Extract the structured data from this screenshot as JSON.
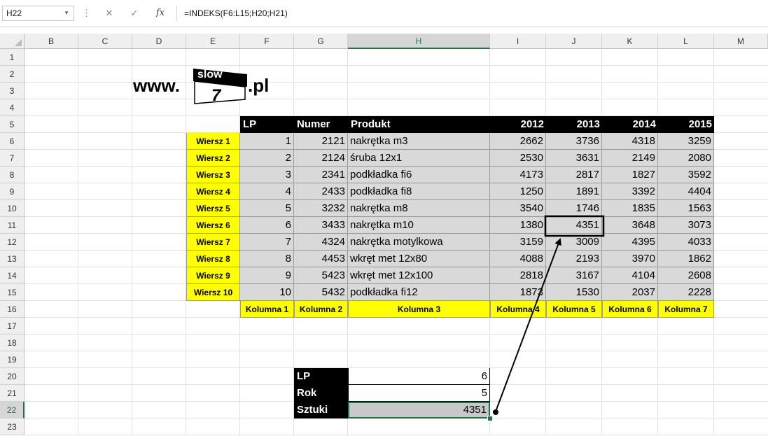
{
  "name_box": "H22",
  "formula": "=INDEKS(F6:L15;H20;H21)",
  "fx_label": "fx",
  "columns": [
    "B",
    "C",
    "D",
    "E",
    "F",
    "G",
    "H",
    "I",
    "J",
    "K",
    "L",
    "M"
  ],
  "rows": [
    "1",
    "2",
    "3",
    "4",
    "5",
    "6",
    "7",
    "8",
    "9",
    "10",
    "11",
    "12",
    "13",
    "14",
    "15",
    "16",
    "17",
    "18",
    "19",
    "20",
    "21",
    "22",
    "23"
  ],
  "logo": {
    "prefix": "www.",
    "top": "slow",
    "mid": "7",
    "suffix": ".pl"
  },
  "table": {
    "headers": [
      "LP",
      "Numer",
      "Produkt",
      "2012",
      "2013",
      "2014",
      "2015"
    ],
    "row_labels": [
      "Wiersz 1",
      "Wiersz 2",
      "Wiersz 3",
      "Wiersz 4",
      "Wiersz 5",
      "Wiersz 6",
      "Wiersz 7",
      "Wiersz 8",
      "Wiersz 9",
      "Wiersz 10"
    ],
    "rows": [
      [
        "1",
        "2121",
        "nakrętka m3",
        "2662",
        "3736",
        "4318",
        "3259"
      ],
      [
        "2",
        "2124",
        "śruba 12x1",
        "2530",
        "3631",
        "2149",
        "2080"
      ],
      [
        "3",
        "2341",
        "podkładka fi6",
        "4173",
        "2817",
        "1827",
        "3592"
      ],
      [
        "4",
        "2433",
        "podkładka fi8",
        "1250",
        "1891",
        "3392",
        "4404"
      ],
      [
        "5",
        "3232",
        "nakrętka m8",
        "3540",
        "1746",
        "1835",
        "1563"
      ],
      [
        "6",
        "3433",
        "nakrętka m10",
        "1380",
        "4351",
        "3648",
        "3073"
      ],
      [
        "7",
        "4324",
        "nakrętka motylkowa",
        "3159",
        "3009",
        "4395",
        "4033"
      ],
      [
        "8",
        "4453",
        "wkręt met 12x80",
        "4088",
        "2193",
        "3970",
        "1862"
      ],
      [
        "9",
        "5423",
        "wkręt met 12x100",
        "2818",
        "3167",
        "4104",
        "2608"
      ],
      [
        "10",
        "5432",
        "podkładka fi12",
        "1873",
        "1530",
        "2037",
        "2228"
      ]
    ],
    "col_labels": [
      "Kolumna 1",
      "Kolumna 2",
      "Kolumna 3",
      "Kolumna 4",
      "Kolumna 5",
      "Kolumna 6",
      "Kolumna 7"
    ]
  },
  "lookup": {
    "labels": [
      "LP",
      "Rok",
      "Sztuki"
    ],
    "values": [
      "6",
      "5",
      "4351"
    ]
  },
  "colors": {
    "accent": "#217346",
    "highlight": "#ffff00",
    "header": "#000000",
    "cell_fill": "#d9d9d9"
  }
}
